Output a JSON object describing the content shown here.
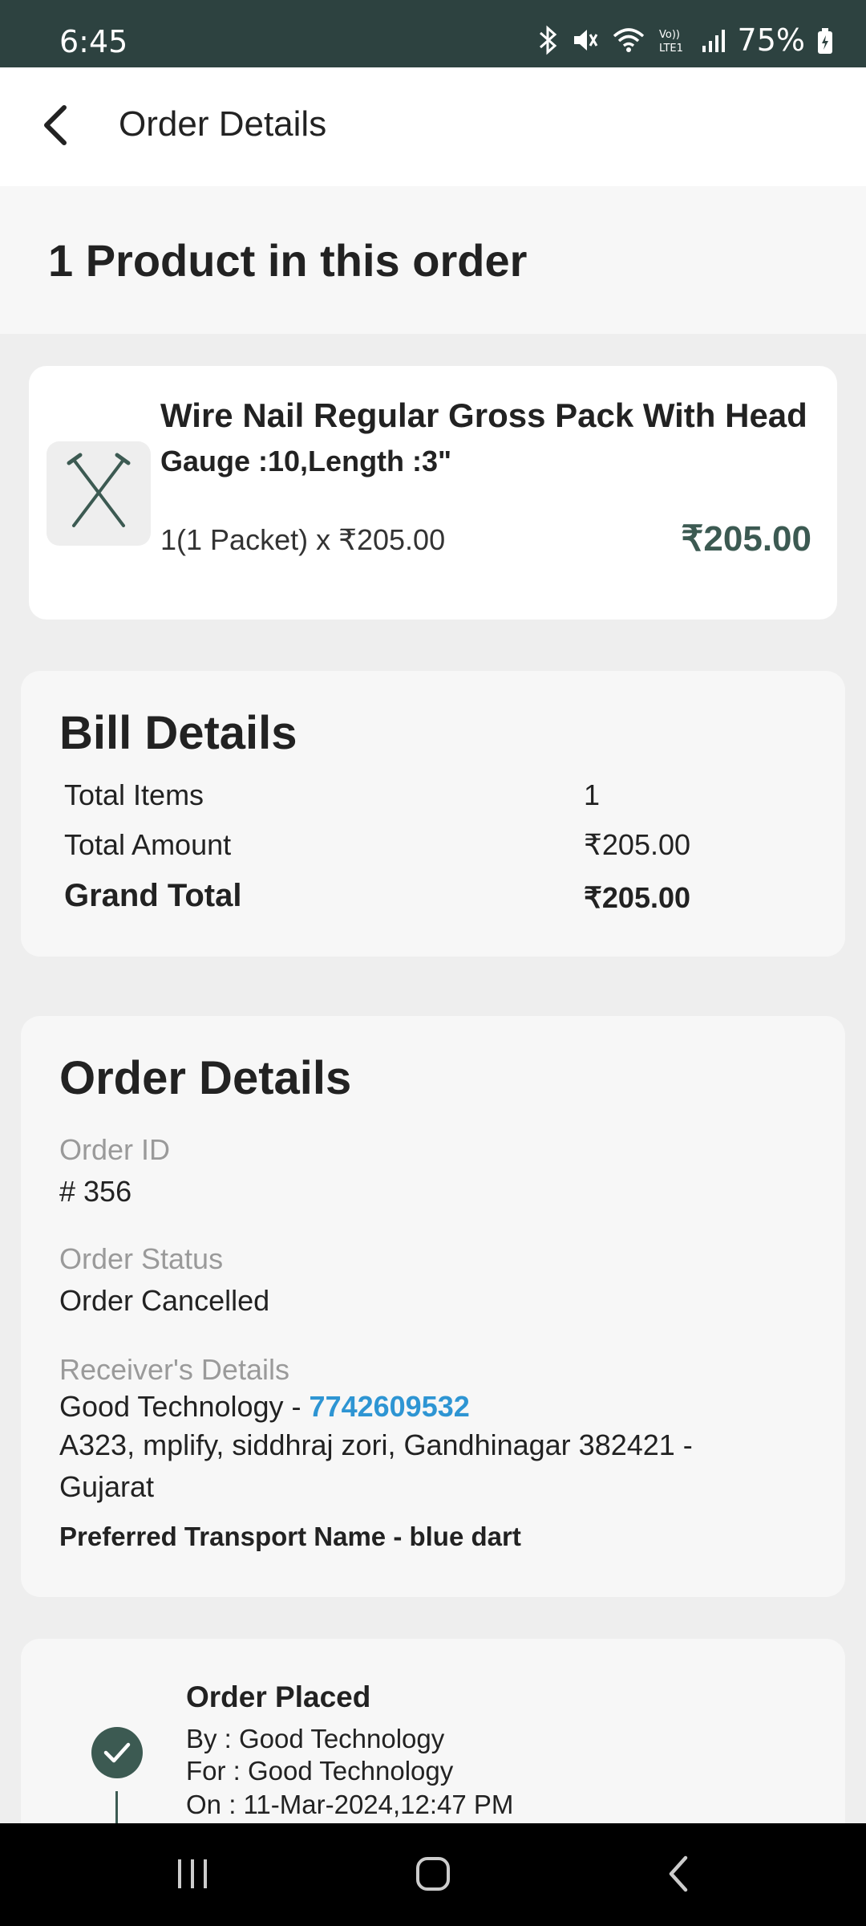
{
  "status_bar": {
    "time": "6:45",
    "battery": "75%"
  },
  "header": {
    "title": "Order Details"
  },
  "order_summary": {
    "product_count_text": "1 Product in this order"
  },
  "product": {
    "name": "Wire Nail Regular Gross Pack With Head",
    "variant": "Gauge :10,Length :3\"",
    "quantity_text": "1(1 Packet) x ₹205.00",
    "price": "₹205.00",
    "image_icon": "nail-icon"
  },
  "bill": {
    "heading": "Bill Details",
    "rows": [
      {
        "label": "Total Items",
        "value": "1"
      },
      {
        "label": "Total Amount",
        "value": "₹205.00"
      },
      {
        "label": "Grand Total",
        "value": "₹205.00"
      }
    ]
  },
  "order": {
    "heading": "Order Details",
    "id_label": "Order ID",
    "id_value": "# 356",
    "status_label": "Order Status",
    "status_value": "Order Cancelled",
    "receiver_label": "Receiver's Details",
    "receiver_name": "Good Technology - ",
    "receiver_phone": "7742609532",
    "address_line1": "A323, mplify, siddhraj zori, Gandhinagar 382421 -",
    "address_line2": "Gujarat",
    "transport": "Preferred Transport Name - blue dart"
  },
  "timeline": {
    "title": "Order Placed",
    "by": "By : Good Technology",
    "for": "For : Good Technology",
    "on": "On : 11-Mar-2024,12:47 PM"
  },
  "colors": {
    "brand": "#2d4240",
    "accent": "#3c5a52",
    "link": "#2e95d3"
  }
}
